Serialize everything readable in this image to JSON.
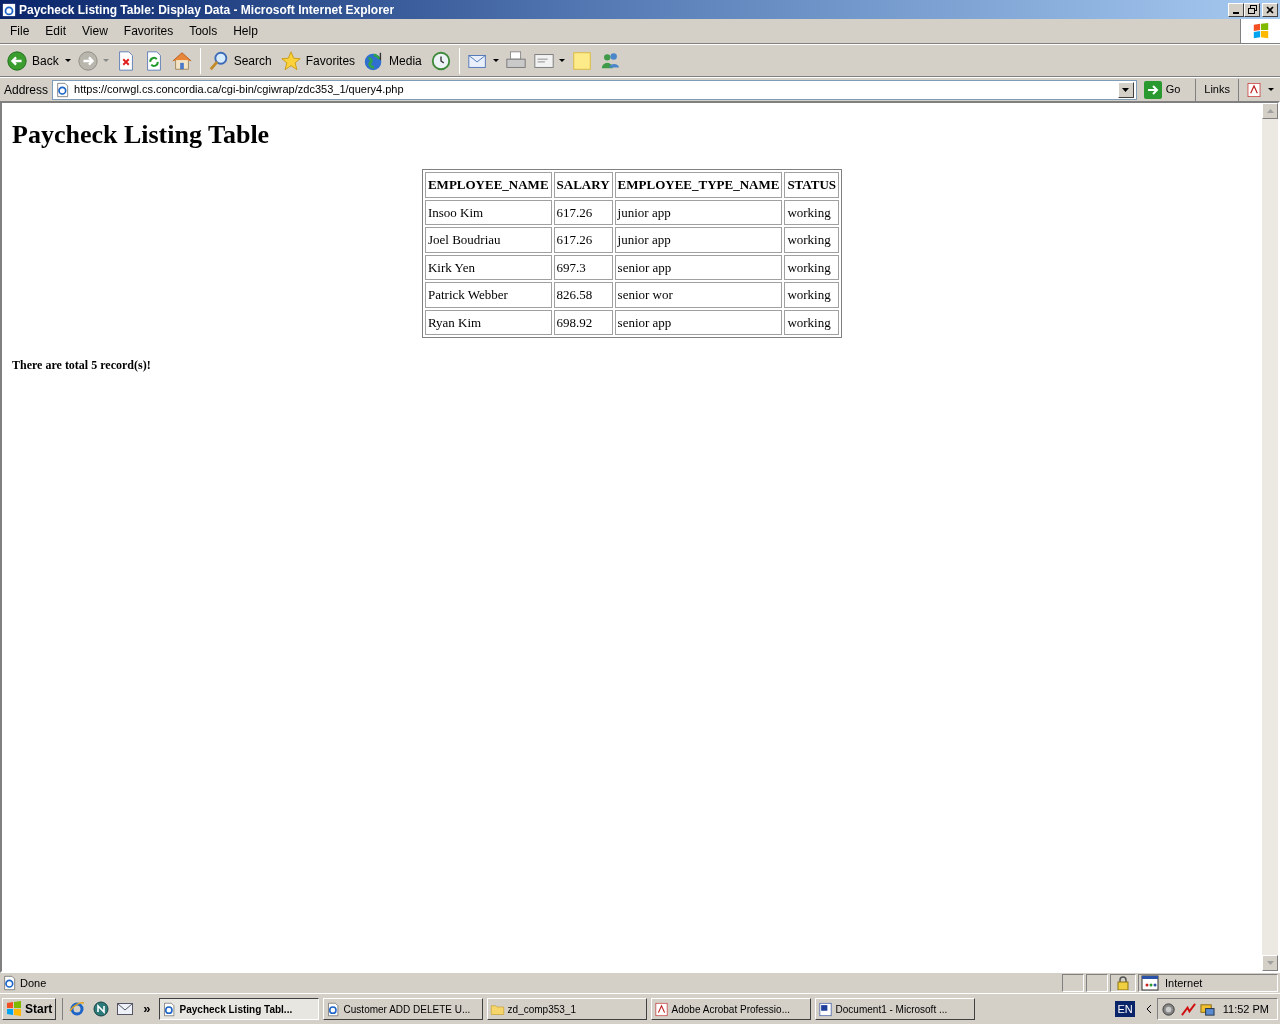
{
  "window": {
    "title": "Paycheck Listing Table: Display Data - Microsoft Internet Explorer"
  },
  "menu": [
    "File",
    "Edit",
    "View",
    "Favorites",
    "Tools",
    "Help"
  ],
  "toolbar": [
    {
      "kind": "back",
      "label": "Back"
    },
    {
      "kind": "forward"
    },
    {
      "kind": "stop"
    },
    {
      "kind": "refresh"
    },
    {
      "kind": "home"
    },
    {
      "kind": "search",
      "label": "Search"
    },
    {
      "kind": "favorites",
      "label": "Favorites"
    },
    {
      "kind": "media",
      "label": "Media"
    },
    {
      "kind": "history"
    },
    {
      "kind": "mail"
    },
    {
      "kind": "print"
    },
    {
      "kind": "edit"
    },
    {
      "kind": "note"
    },
    {
      "kind": "messenger"
    }
  ],
  "address_bar": {
    "label": "Address",
    "url": "https://corwgl.cs.concordia.ca/cgi-bin/cgiwrap/zdc353_1/query4.php",
    "go": "Go",
    "links": "Links"
  },
  "page": {
    "heading": "Paycheck Listing Table",
    "table": {
      "columns": [
        "EMPLOYEE_NAME",
        "SALARY",
        "EMPLOYEE_TYPE_NAME",
        "STATUS"
      ],
      "rows": [
        [
          "Insoo Kim",
          "617.26",
          "junior app",
          "working"
        ],
        [
          "Joel Boudriau",
          "617.26",
          "junior app",
          "working"
        ],
        [
          "Kirk Yen",
          "697.3",
          "senior app",
          "working"
        ],
        [
          "Patrick Webber",
          "826.58",
          "senior wor",
          "working"
        ],
        [
          "Ryan Kim",
          "698.92",
          "senior app",
          "working"
        ]
      ]
    },
    "summary": "There are total 5 record(s)!"
  },
  "status_bar": {
    "text": "Done",
    "zone": "Internet"
  },
  "taskbar": {
    "start": "Start",
    "more": "»",
    "tasks": [
      {
        "kind": "ie",
        "label": "Paycheck Listing Tabl...",
        "selected": true
      },
      {
        "kind": "ie",
        "label": "Customer ADD DELETE U...",
        "selected": false
      },
      {
        "kind": "folder",
        "label": "zd_comp353_1",
        "selected": false
      },
      {
        "kind": "acrobat",
        "label": "Adobe Acrobat Professio...",
        "selected": false
      },
      {
        "kind": "word",
        "label": "Document1 - Microsoft ...",
        "selected": false
      }
    ],
    "language": "EN",
    "clock": "11:52 PM"
  }
}
